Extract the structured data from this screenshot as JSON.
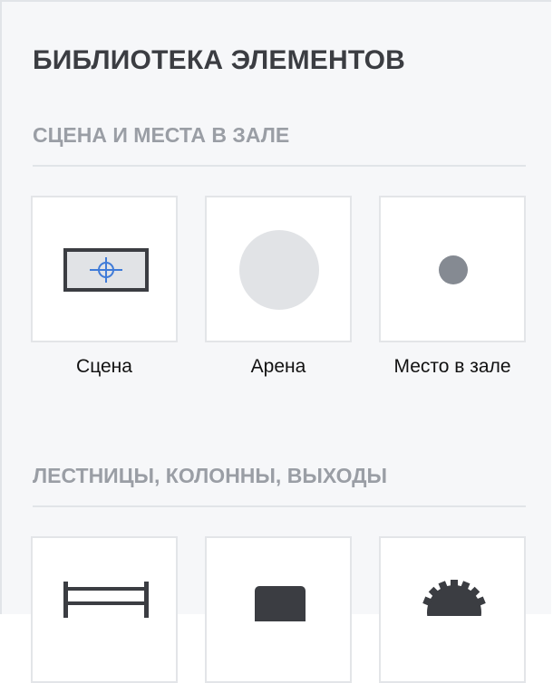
{
  "library": {
    "title": "БИБЛИОТЕКА ЭЛЕМЕНТОВ"
  },
  "sections": [
    {
      "title": "СЦЕНА И МЕСТА В ЗАЛЕ",
      "items": [
        {
          "label": "Сцена",
          "icon": "stage-icon"
        },
        {
          "label": "Арена",
          "icon": "arena-icon"
        },
        {
          "label": "Место в зале",
          "icon": "seat-icon"
        }
      ]
    },
    {
      "title": "ЛЕСТНИЦЫ, КОЛОННЫ, ВЫХОДЫ",
      "items": [
        {
          "label": "",
          "icon": "stairs-icon"
        },
        {
          "label": "",
          "icon": "column-icon"
        },
        {
          "label": "",
          "icon": "exit-gear-icon"
        }
      ]
    }
  ],
  "colors": {
    "stage_fill": "#e1e3e6",
    "stage_border": "#3b3d42",
    "stage_target": "#3f7bd8",
    "arena_fill": "#e1e3e6",
    "seat_fill": "#858a92",
    "dark_icon": "#3b3d42"
  }
}
